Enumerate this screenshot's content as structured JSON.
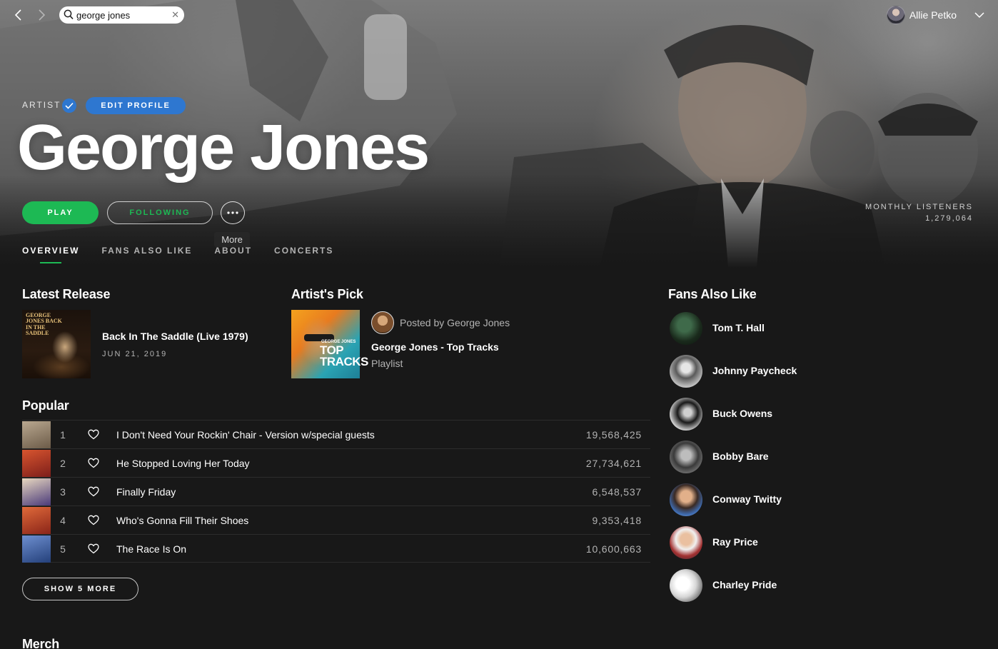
{
  "search": {
    "value": "george jones"
  },
  "user": {
    "name": "Allie Petko"
  },
  "artist": {
    "label": "ARTIST",
    "edit_profile_label": "EDIT PROFILE",
    "name": "George Jones",
    "play_label": "PLAY",
    "following_label": "FOLLOWING",
    "more_tooltip": "More",
    "monthly_listeners_label": "MONTHLY LISTENERS",
    "monthly_listeners": "1,279,064"
  },
  "tabs": [
    {
      "label": "OVERVIEW",
      "active": true
    },
    {
      "label": "FANS ALSO LIKE",
      "active": false
    },
    {
      "label": "ABOUT",
      "active": false
    },
    {
      "label": "CONCERTS",
      "active": false
    }
  ],
  "latest_release": {
    "heading": "Latest Release",
    "cover_text": "GEORGE JONES BACK IN THE SADDLE",
    "title": "Back In The Saddle (Live 1979)",
    "date": "JUN 21, 2019"
  },
  "artists_pick": {
    "heading": "Artist's Pick",
    "posted_by": "Posted by George Jones",
    "title": "George Jones - Top Tracks",
    "type": "Playlist",
    "cover_small": "GEORGE JONES",
    "cover_big": "TOP TRACKS"
  },
  "popular": {
    "heading": "Popular",
    "show_more_label": "SHOW 5 MORE",
    "tracks": [
      {
        "num": "1",
        "title": "I Don't Need Your Rockin' Chair - Version w/special guests",
        "plays": "19,568,425",
        "thumb": "#8c7a66"
      },
      {
        "num": "2",
        "title": "He Stopped Loving Her Today",
        "plays": "27,734,621",
        "thumb": "#b23a2a"
      },
      {
        "num": "3",
        "title": "Finally Friday",
        "plays": "6,548,537",
        "thumb": "#5b4a8a"
      },
      {
        "num": "4",
        "title": "Who's Gonna Fill Their Shoes",
        "plays": "9,353,418",
        "thumb": "#b8402e"
      },
      {
        "num": "5",
        "title": "The Race Is On",
        "plays": "10,600,663",
        "thumb": "#3d5fa3"
      }
    ]
  },
  "fans_also_like": {
    "heading": "Fans Also Like",
    "artists": [
      {
        "name": "Tom T. Hall",
        "color": "#1f2a22"
      },
      {
        "name": "Johnny Paycheck",
        "color": "#9a9a9a"
      },
      {
        "name": "Buck Owens",
        "color": "#2b2b2b"
      },
      {
        "name": "Bobby Bare",
        "color": "#5a5a5a"
      },
      {
        "name": "Conway Twitty",
        "color": "#3b5f9a"
      },
      {
        "name": "Ray Price",
        "color": "#6a3c3c"
      },
      {
        "name": "Charley Pride",
        "color": "#c8c8c8"
      }
    ]
  },
  "merch": {
    "heading": "Merch"
  },
  "colors": {
    "accent": "#1db954",
    "blue": "#2e77d0",
    "background": "#181818"
  }
}
